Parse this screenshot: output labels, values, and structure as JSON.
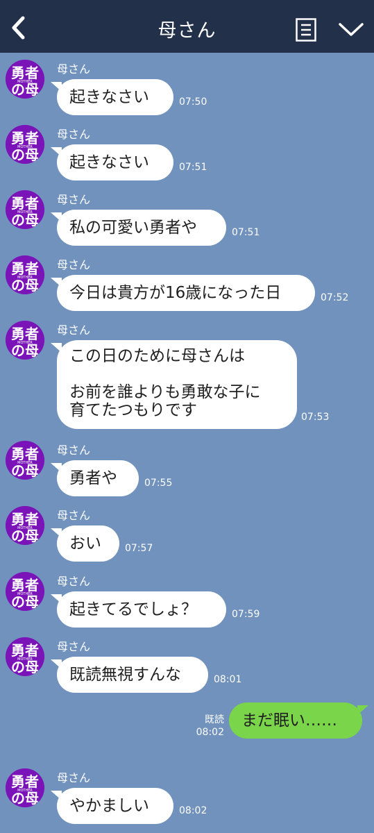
{
  "header": {
    "title": "母さん",
    "back_icon": "chevron-left-icon",
    "menu_icon": "document-menu-icon",
    "expand_icon": "chevron-down-icon"
  },
  "avatar": {
    "line1": "勇者",
    "line2": "の母",
    "sub": "MOTHER"
  },
  "messages": [
    {
      "sender": "母さん",
      "text": "起きなさい",
      "time": "07:50"
    },
    {
      "sender": "母さん",
      "text": "起きなさい",
      "time": "07:51"
    },
    {
      "sender": "母さん",
      "text": "私の可愛い勇者や",
      "time": "07:51"
    },
    {
      "sender": "母さん",
      "text": "今日は貴方が16歳になった日",
      "time": "07:52"
    },
    {
      "sender": "母さん",
      "text": "この日のために母さんは\n\nお前を誰よりも勇敢な子に\n育てたつもりです",
      "time": "07:53"
    },
    {
      "sender": "母さん",
      "text": "勇者や",
      "time": "07:55"
    },
    {
      "sender": "母さん",
      "text": "おい",
      "time": "07:57"
    },
    {
      "sender": "母さん",
      "text": "起きてるでしょ？",
      "time": "07:59"
    },
    {
      "sender": "母さん",
      "text": "既読無視すんな",
      "time": "08:01"
    },
    {
      "sender": "母さん",
      "text": "やかましい",
      "time": "08:02"
    }
  ],
  "my_message": {
    "text": "まだ眠い……",
    "read": "既読",
    "time": "08:02"
  },
  "colors": {
    "background": "#7092bd",
    "header": "#233049",
    "my_bubble": "#7ad54a",
    "avatar": "#7b14b8"
  }
}
